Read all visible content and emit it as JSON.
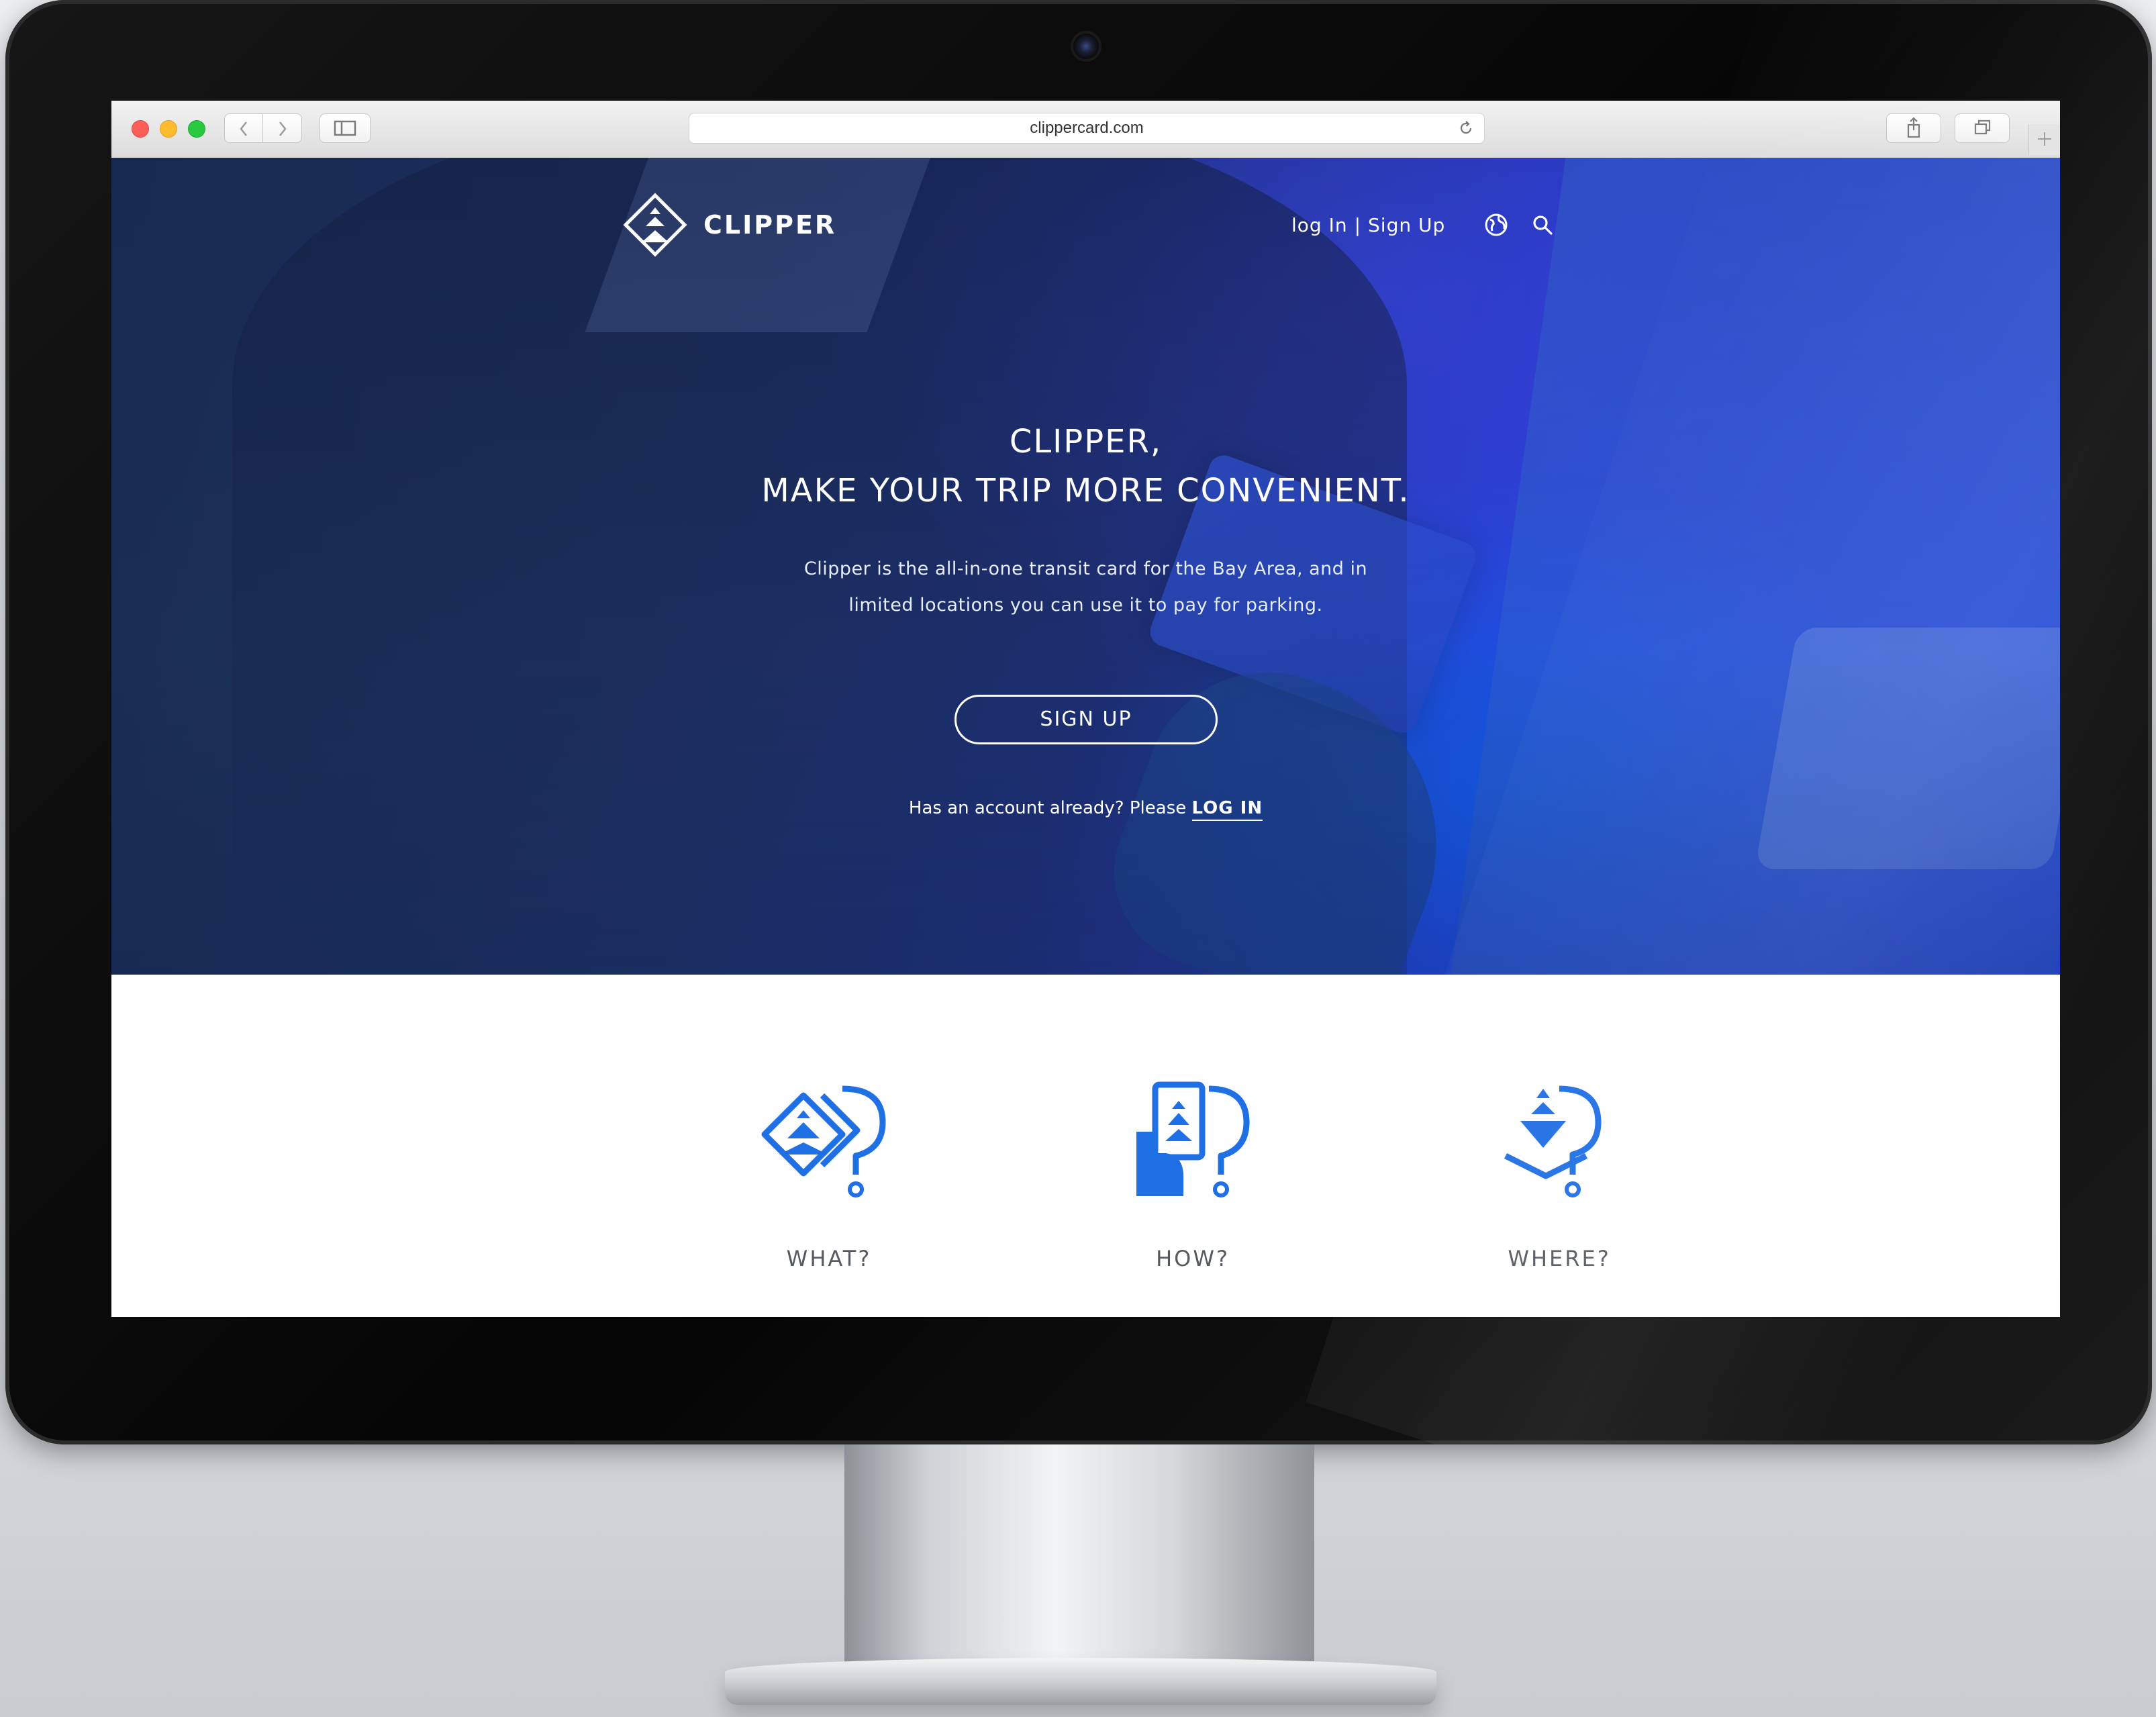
{
  "browser": {
    "url": "clippercard.com"
  },
  "site": {
    "logo_text": "CLIPPER",
    "nav": {
      "login": "log In",
      "separator": "|",
      "signup": "Sign Up"
    },
    "hero": {
      "title_line1": "CLIPPER,",
      "title_line2": "MAKE YOUR TRIP MORE CONVENIENT.",
      "text_line1": "Clipper is the all-in-one transit card for the Bay Area, and in",
      "text_line2": "limited locations you can use it to pay for parking.",
      "signup_button": "SIGN UP",
      "account_prompt": "Has an account already? Please",
      "login_link": "LOG IN"
    },
    "features": [
      {
        "label": "WHAT?",
        "icon": "card-question-icon"
      },
      {
        "label": "HOW?",
        "icon": "hand-card-question-icon"
      },
      {
        "label": "WHERE?",
        "icon": "location-question-icon"
      }
    ]
  },
  "colors": {
    "brand_blue": "#1f6fe5",
    "hero_blue": "#2d47f0",
    "text_gray": "#555a61"
  }
}
